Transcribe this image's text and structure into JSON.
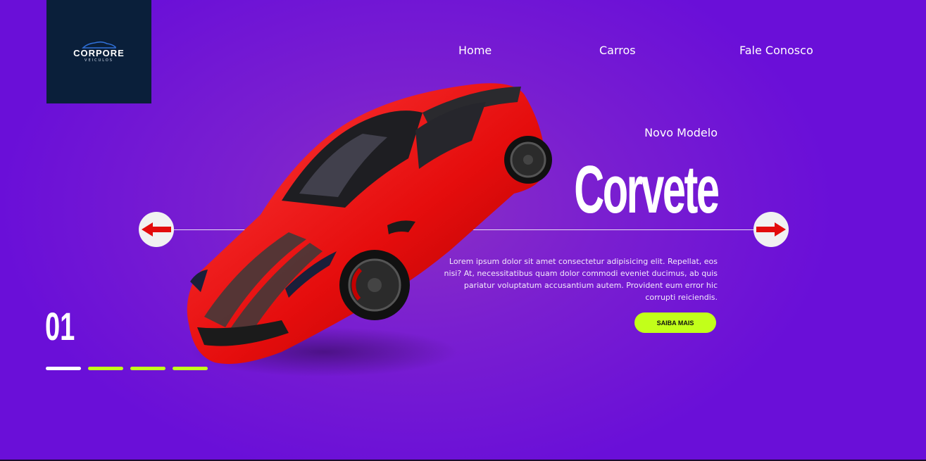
{
  "brand": {
    "name": "CORPORE",
    "tagline": "VEICULOS"
  },
  "nav": {
    "home": "Home",
    "cars": "Carros",
    "contact": "Fale Conosco"
  },
  "hero": {
    "subtitle": "Novo Modelo",
    "model": "Corvete",
    "description": "Lorem ipsum dolor sit amet consectetur adipisicing elit. Repellat, eos nisi? At, necessitatibus quam dolor commodi eveniet ducimus, ab quis pariatur voluptatum accusantium autem. Provident eum error hic corrupti reiciendis.",
    "cta": "SAIBA MAIS"
  },
  "slider": {
    "current": "01",
    "total_dots": 4,
    "active_index": 0
  },
  "icons": {
    "prev": "arrow-left-icon",
    "next": "arrow-right-icon",
    "car_image": "red-sports-car"
  },
  "colors": {
    "accent": "#c2ff1a",
    "arrow": "#e30b0b",
    "logo_bg": "#0a1f3a",
    "bg": "#6a0fd8"
  }
}
